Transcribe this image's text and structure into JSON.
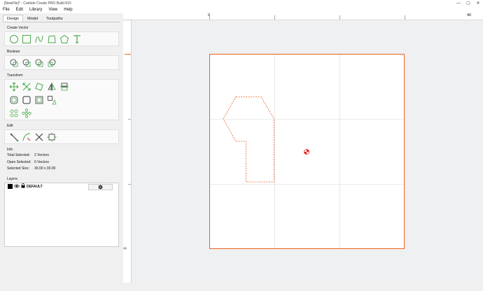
{
  "window": {
    "title": "[NewFile]* - Carbide Create PRO Build 815",
    "controls": {
      "minimize": "—",
      "maximize": "▢",
      "close": "✕"
    }
  },
  "menu": [
    "File",
    "Edit",
    "Library",
    "View",
    "Help"
  ],
  "tabs": [
    {
      "label": "Design",
      "active": true
    },
    {
      "label": "Model",
      "active": false
    },
    {
      "label": "Toolpaths",
      "active": false
    }
  ],
  "sections": {
    "create_vector": "Create Vector",
    "boolean": "Boolean",
    "transform": "Transform",
    "edit": "Edit",
    "info": "Info",
    "layers": "Layers"
  },
  "icons": {
    "create_vector": [
      "circle-icon",
      "rectangle-icon",
      "curve-icon",
      "polyline-icon",
      "polygon-icon",
      "text-icon"
    ],
    "boolean": [
      "union-icon",
      "subtract-icon",
      "intersect-icon",
      "weld-icon"
    ],
    "transform_row1": [
      "move-icon",
      "scale-icon",
      "rotate-icon",
      "mirror-icon",
      "align-icon"
    ],
    "transform_row2": [
      "offset-icon",
      "fillet-icon",
      "inset-icon",
      "array-icon"
    ],
    "transform_row3": [
      "grid-array-icon",
      "circular-array-icon"
    ],
    "edit": [
      "node-edit-icon",
      "trim-icon",
      "cut-icon",
      "join-icon"
    ]
  },
  "info": {
    "total_selected_label": "Total Selected:",
    "total_selected_value": "2 Vectors",
    "open_selected_label": "Open Selected:",
    "open_selected_value": "0 Vectors",
    "selected_size_label": "Selected Size:",
    "selected_size_value": "30.00 x 30.00"
  },
  "layers": {
    "items": [
      {
        "name": "DEFAULT",
        "color": "#000000"
      }
    ]
  },
  "ruler": {
    "top_labels": [
      "0",
      "40"
    ],
    "left_labels": [
      "0"
    ]
  },
  "colors": {
    "accent_green": "#49a84a",
    "vector_orange": "#e8631f",
    "origin_red": "#e02020"
  }
}
